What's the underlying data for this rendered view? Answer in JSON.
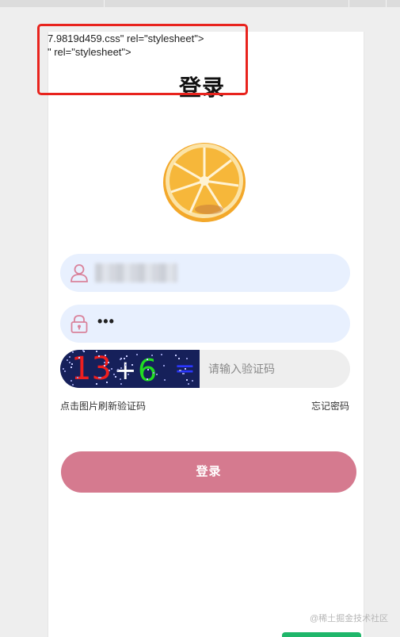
{
  "raw_text": {
    "line1": "7.9819d459.css\" rel=\"stylesheet\">",
    "line2": "\" rel=\"stylesheet\">"
  },
  "page": {
    "title": "登录"
  },
  "username": {
    "value": "",
    "icon": "user-icon"
  },
  "password": {
    "value": "•••",
    "icon": "lock-icon"
  },
  "captcha": {
    "image_text": {
      "n1": "13",
      "op": "+",
      "n2": "6",
      "eq": "="
    },
    "input_placeholder": "请输入验证码",
    "hint": "点击图片刷新验证码"
  },
  "links": {
    "forgot": "忘记密码"
  },
  "button": {
    "login": "登录"
  },
  "watermark": "@稀土掘金技术社区",
  "colors": {
    "accent": "#d57a8f",
    "field_bg": "#e8f0fe",
    "captcha_bg": "#16205a",
    "highlight_border": "#e8231d",
    "bottom_tab": "#1fb66a"
  }
}
